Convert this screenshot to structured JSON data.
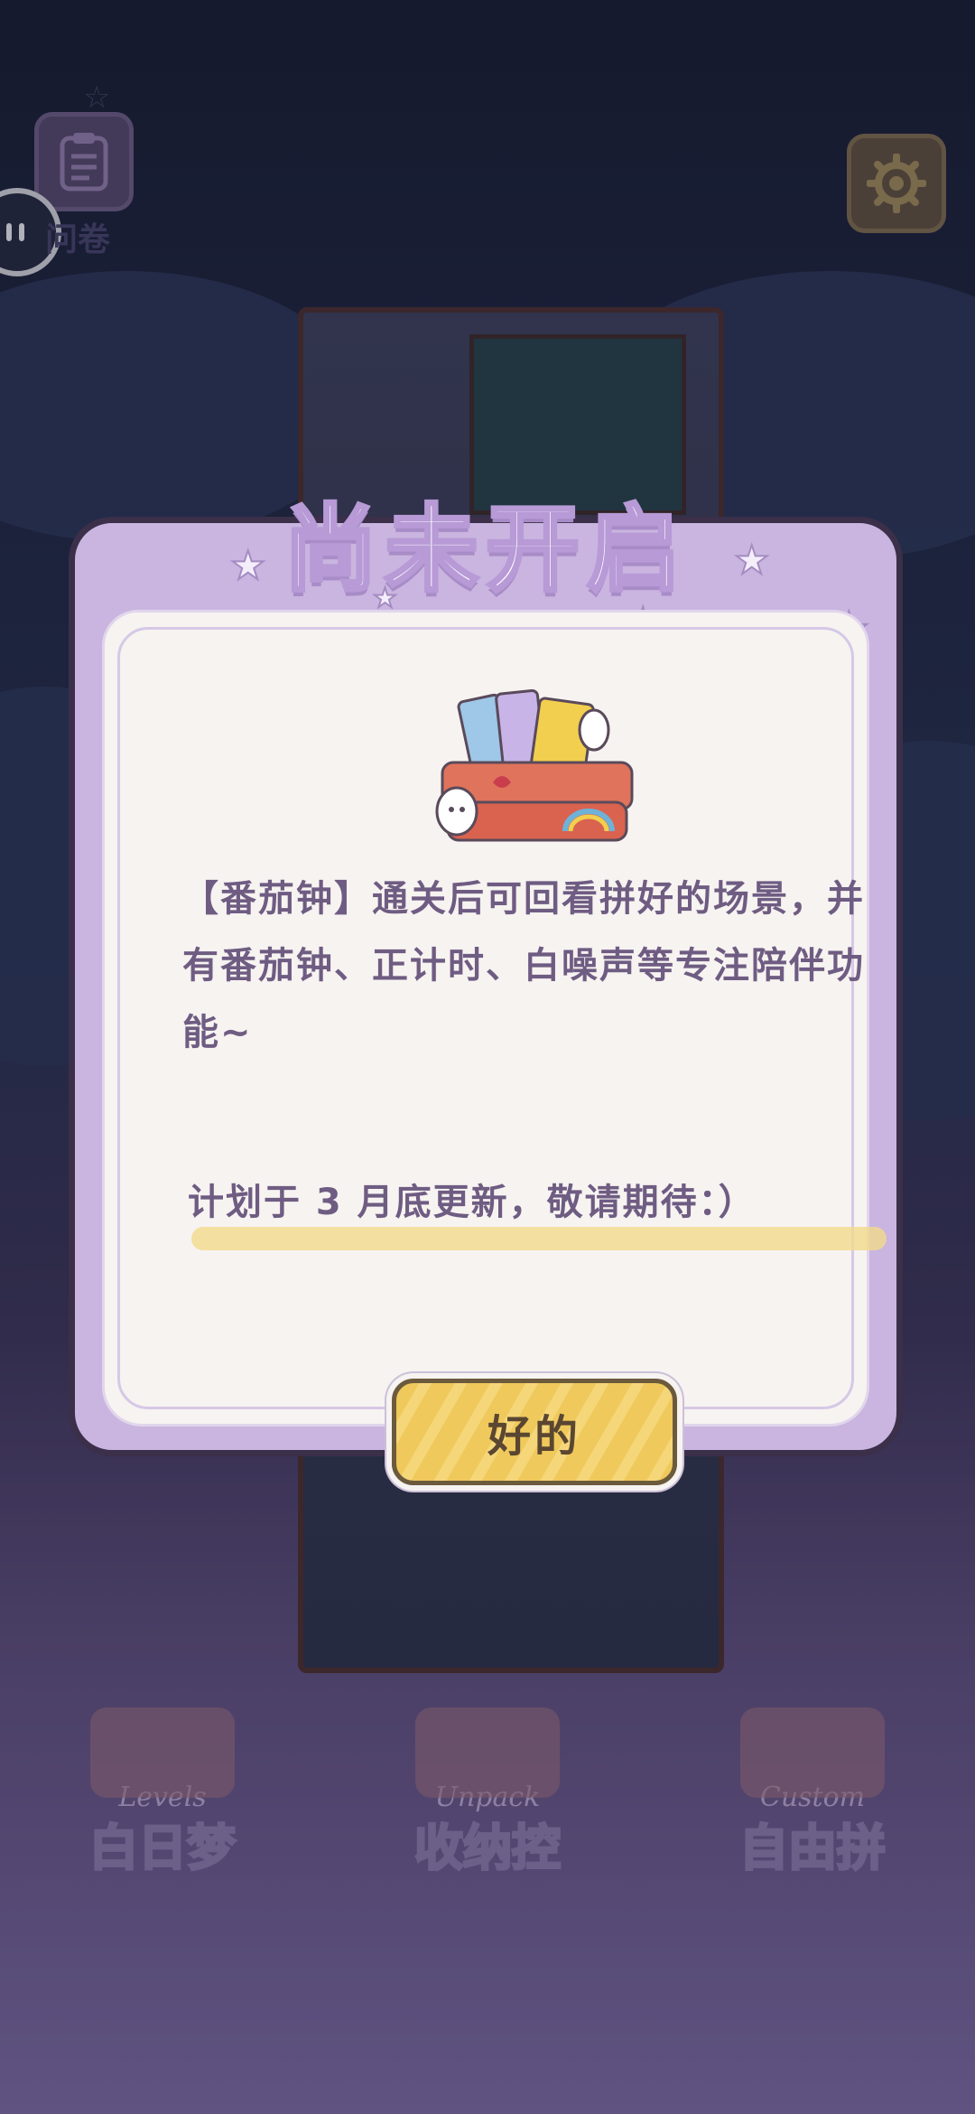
{
  "top_bar": {
    "survey_label": "问卷",
    "survey_icon": "clipboard-icon",
    "settings_icon": "gear-icon"
  },
  "bottom_menu": {
    "items": [
      {
        "sub": "Levels",
        "label": "白日梦"
      },
      {
        "sub": "Unpack",
        "label": "收纳控"
      },
      {
        "sub": "Custom",
        "label": "自由拼"
      }
    ]
  },
  "modal": {
    "title": "尚未开启",
    "description": "【番茄钟】通关后可回看拼好的场景，并有番茄钟、正计时、白噪声等专注陪伴功能~",
    "plan": "计划于 3 月底更新，敬请期待：）",
    "ok_label": "好的"
  },
  "colors": {
    "modal_border": "#c9b5df",
    "modal_content_bg": "#f6f3f1",
    "text_purple": "#6f5c82",
    "button_yellow": "#efc95b"
  }
}
